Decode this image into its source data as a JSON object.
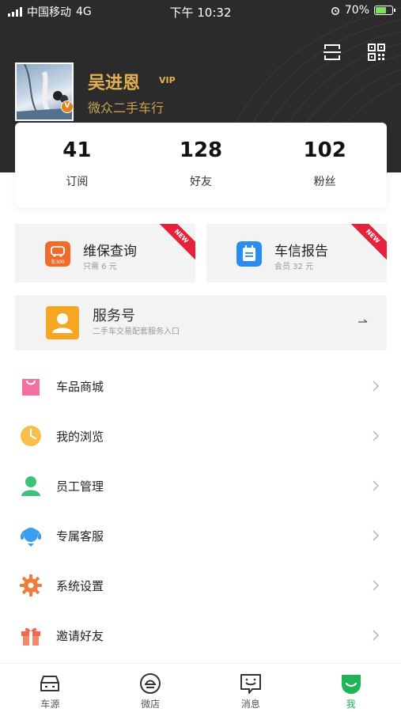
{
  "status_bar": {
    "carrier": "中国移动",
    "network": "4G",
    "time": "下午 10:32",
    "battery_percent": "70%",
    "battery_level": 0.7
  },
  "profile": {
    "name": "吴进恩",
    "vip_label": "VIP",
    "company": "微众二手车行",
    "badge": "V"
  },
  "stats": [
    {
      "value": "41",
      "label": "订阅"
    },
    {
      "value": "128",
      "label": "好友"
    },
    {
      "value": "102",
      "label": "粉丝"
    }
  ],
  "features": [
    {
      "title": "维保查询",
      "subtitle": "只需 6 元",
      "ribbon": "NEW",
      "icon": "car-300-icon",
      "icon_text": "车300",
      "color": "#f06a2a"
    },
    {
      "title": "车信报告",
      "subtitle": "会员 32 元",
      "ribbon": "NEW",
      "icon": "report-icon",
      "color": "#2a8cf0"
    }
  ],
  "service": {
    "title": "服务号",
    "subtitle": "二手车交易配套服务入口",
    "icon": "user-icon"
  },
  "menu": [
    {
      "label": "车品商城",
      "icon": "shopping-bag-icon",
      "color": "#f05a8c"
    },
    {
      "label": "我的浏览",
      "icon": "clock-icon",
      "color": "#f5b940"
    },
    {
      "label": "员工管理",
      "icon": "staff-icon",
      "color": "#3ec27a"
    },
    {
      "label": "专属客服",
      "icon": "headset-icon",
      "color": "#3a9ef0"
    },
    {
      "label": "系统设置",
      "icon": "gear-icon",
      "color": "#f07a3a"
    },
    {
      "label": "邀请好友",
      "icon": "gift-icon",
      "color": "#f06a4a"
    }
  ],
  "tabs": [
    {
      "label": "车源",
      "icon": "car-icon",
      "active": false
    },
    {
      "label": "微店",
      "icon": "shop-icon",
      "active": false
    },
    {
      "label": "消息",
      "icon": "message-icon",
      "active": false
    },
    {
      "label": "我",
      "icon": "me-icon",
      "active": true
    }
  ],
  "colors": {
    "header_bg": "#2b2b2b",
    "gold": "#e2b04f",
    "accent_green": "#1fb455",
    "ribbon_red": "#e8213a"
  }
}
